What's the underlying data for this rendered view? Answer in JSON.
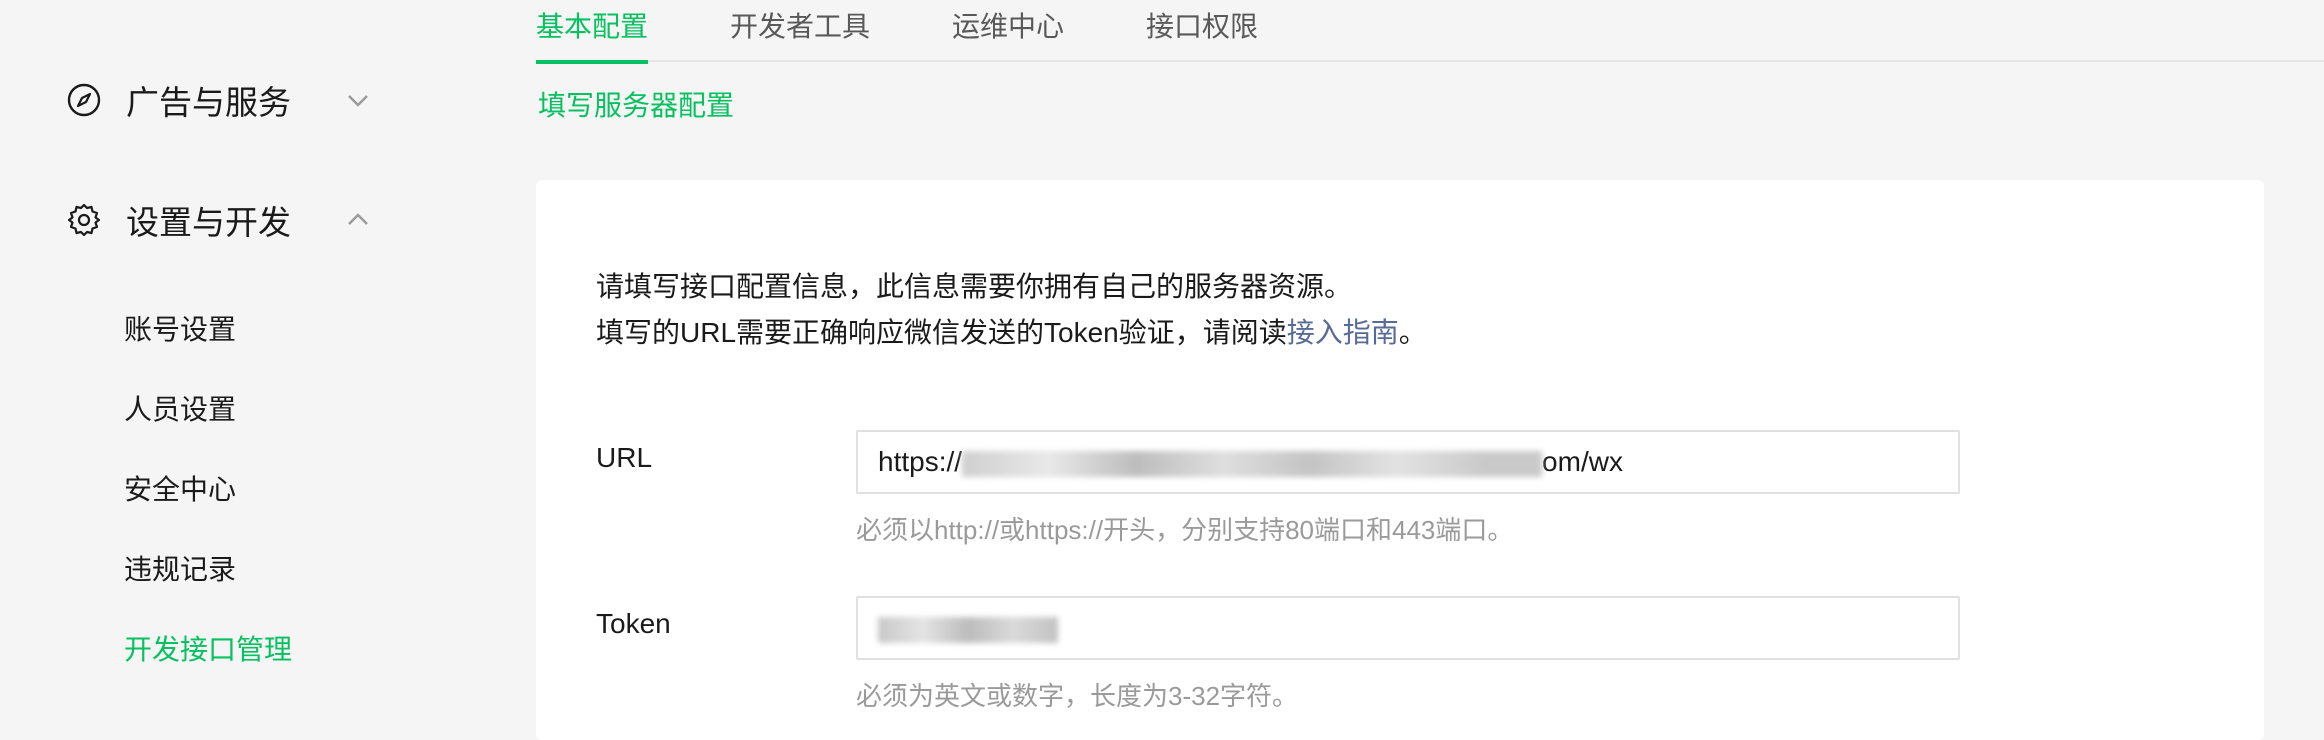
{
  "sidebar": {
    "groups": [
      {
        "label": "广告与服务",
        "icon": "compass-icon",
        "expanded": false
      },
      {
        "label": "设置与开发",
        "icon": "gear-icon",
        "expanded": true
      }
    ],
    "sub_items": [
      {
        "label": "账号设置",
        "active": false
      },
      {
        "label": "人员设置",
        "active": false
      },
      {
        "label": "安全中心",
        "active": false
      },
      {
        "label": "违规记录",
        "active": false
      },
      {
        "label": "开发接口管理",
        "active": true
      }
    ]
  },
  "tabs": [
    {
      "label": "基本配置",
      "active": true
    },
    {
      "label": "开发者工具",
      "active": false
    },
    {
      "label": "运维中心",
      "active": false
    },
    {
      "label": "接口权限",
      "active": false
    }
  ],
  "section_title": "填写服务器配置",
  "notice": {
    "line1": "请填写接口配置信息，此信息需要你拥有自己的服务器资源。",
    "line2_prefix": "填写的URL需要正确响应微信发送的Token验证，请阅读",
    "line2_link": "接入指南",
    "line2_suffix": "。"
  },
  "form": {
    "url": {
      "label": "URL",
      "value_start": "https://",
      "value_end": "om/wx",
      "hint": "必须以http://或https://开头，分别支持80端口和443端口。"
    },
    "token": {
      "label": "Token",
      "hint": "必须为英文或数字，长度为3-32字符。"
    }
  },
  "colors": {
    "accent": "#07c160",
    "link": "#576b95",
    "hint": "#9a9a9a",
    "background": "#f5f5f5"
  }
}
